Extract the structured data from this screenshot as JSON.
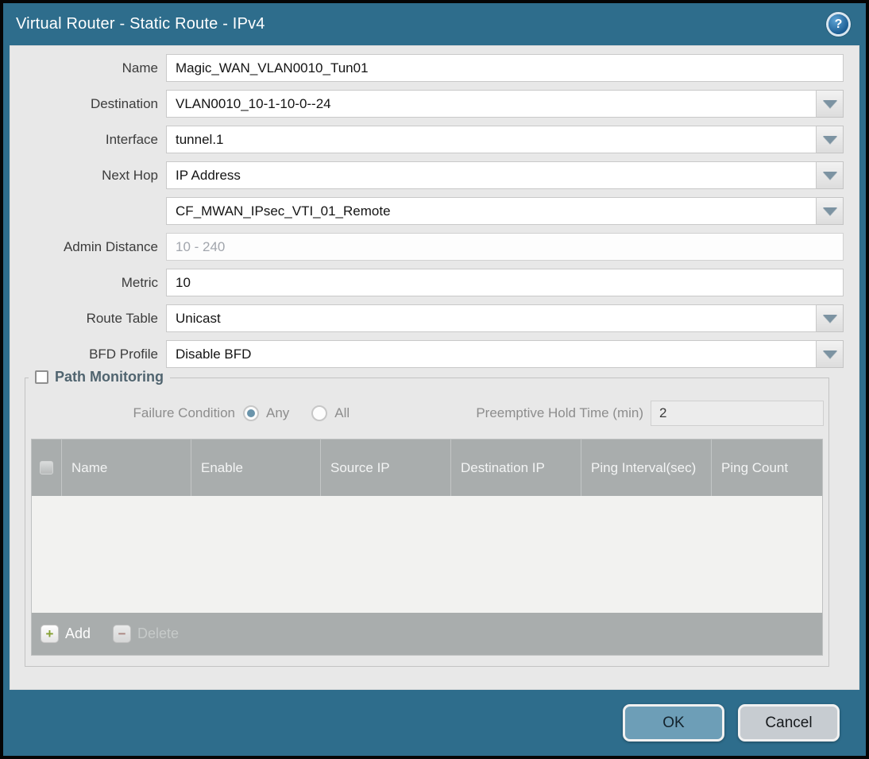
{
  "title_bar": {
    "title": "Virtual Router - Static Route - IPv4",
    "help_icon": "question-mark-circle-icon",
    "help_glyph": "?"
  },
  "colors": {
    "window_teal": "#2e6d8c",
    "panel_gray": "#e8e8e8",
    "table_header_gray": "#a9adad",
    "ok_button": "#6d9eb7",
    "cancel_button": "#c7ccd1",
    "radio_selected": "#6a94ab",
    "add_plus_green": "#85a033",
    "delete_minus_red": "#aa7a72"
  },
  "form": {
    "name": {
      "label": "Name",
      "value": "Magic_WAN_VLAN0010_Tun01"
    },
    "destination": {
      "label": "Destination",
      "value": "VLAN0010_10-1-10-0--24"
    },
    "interface": {
      "label": "Interface",
      "value": "tunnel.1"
    },
    "next_hop": {
      "label": "Next Hop",
      "value": "IP Address"
    },
    "next_hop_address": {
      "value": "CF_MWAN_IPsec_VTI_01_Remote"
    },
    "admin_distance": {
      "label": "Admin Distance",
      "value": "",
      "placeholder": "10 - 240"
    },
    "metric": {
      "label": "Metric",
      "value": "10"
    },
    "route_table": {
      "label": "Route Table",
      "value": "Unicast"
    },
    "bfd_profile": {
      "label": "BFD Profile",
      "value": "Disable BFD"
    }
  },
  "path_monitoring": {
    "title": "Path Monitoring",
    "checkbox_checked": false,
    "failure_condition": {
      "label": "Failure Condition",
      "options": [
        {
          "label": "Any",
          "selected": true
        },
        {
          "label": "All",
          "selected": false
        }
      ]
    },
    "preemptive_hold_time": {
      "label": "Preemptive Hold Time (min)",
      "value": "2"
    },
    "table": {
      "columns": [
        "Name",
        "Enable",
        "Source IP",
        "Destination IP",
        "Ping Interval(sec)",
        "Ping Count"
      ],
      "rows": []
    },
    "toolbar": {
      "add_label": "Add",
      "add_glyph": "+",
      "delete_label": "Delete",
      "delete_glyph": "−",
      "delete_enabled": false
    }
  },
  "footer": {
    "ok_label": "OK",
    "cancel_label": "Cancel"
  }
}
